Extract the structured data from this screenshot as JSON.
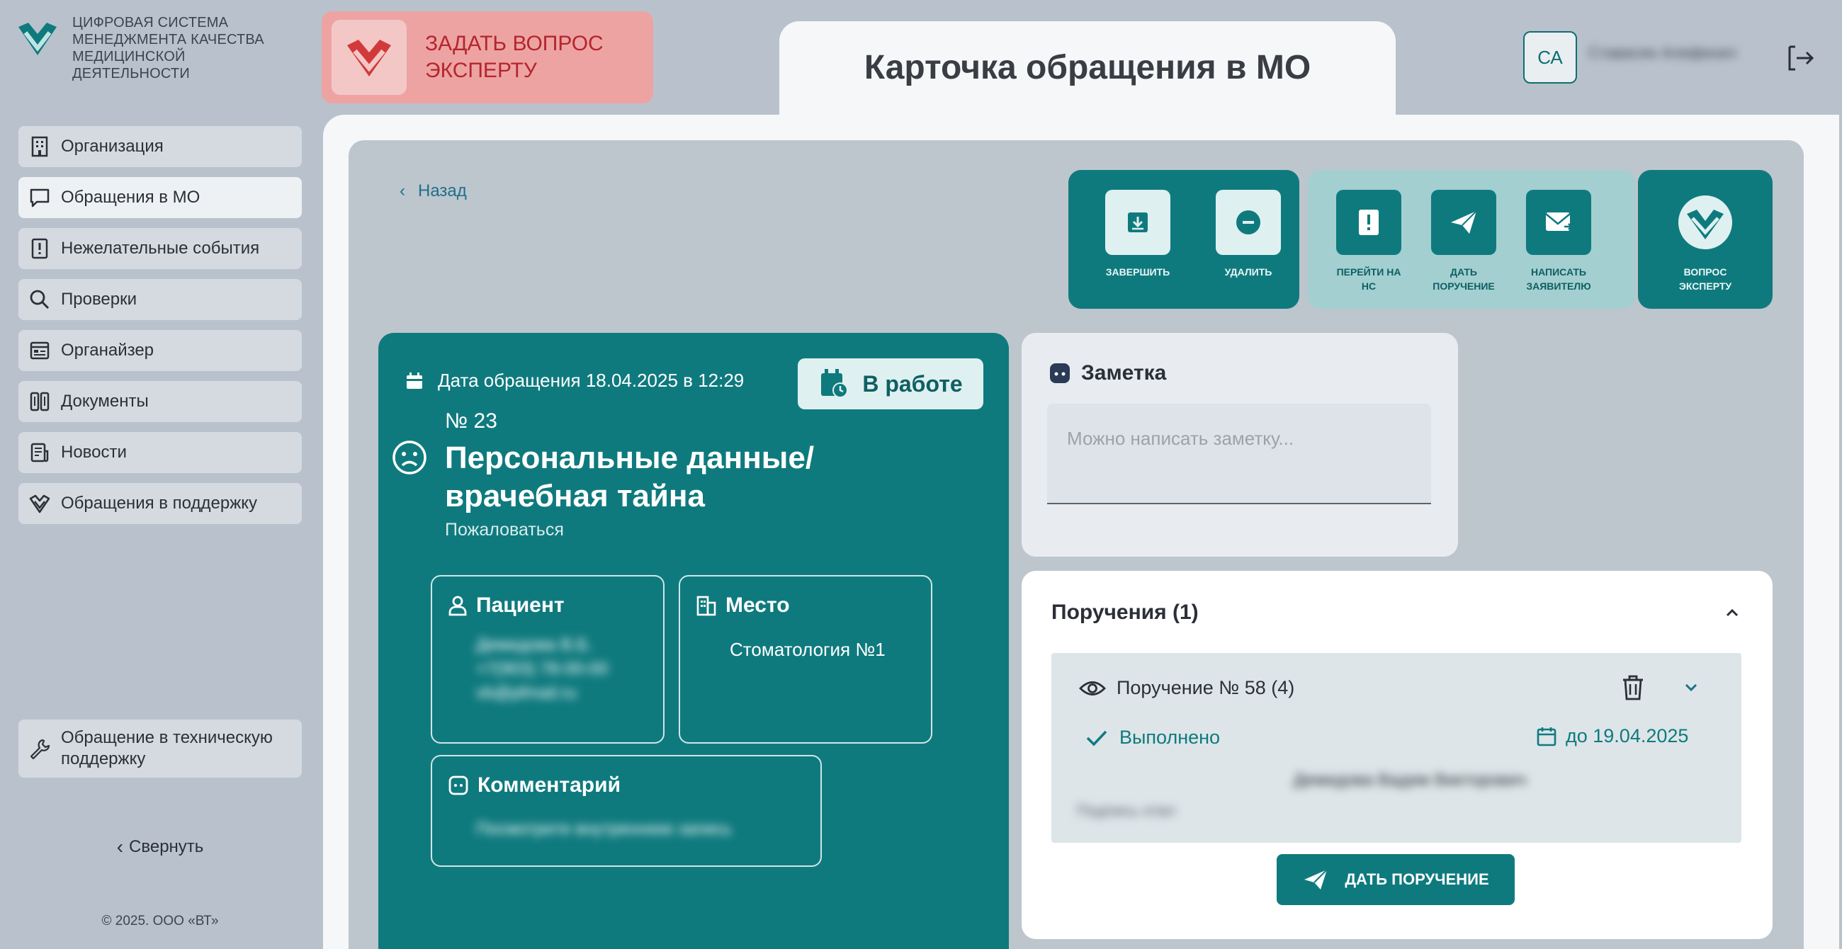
{
  "brand": {
    "name": "ЦИФРОВАЯ СИСТЕМА\nМЕНЕДЖМЕНТА КАЧЕСТВА\nМЕДИЦИНСКОЙ\nДЕЯТЕЛЬНОСТИ",
    "accent": "#0f7a7e"
  },
  "sidebar": {
    "items": [
      {
        "label": "Организация",
        "icon": "building-icon"
      },
      {
        "label": "Обращения в МО",
        "icon": "chat-icon",
        "active": true
      },
      {
        "label": "Нежелательные события",
        "icon": "alert-book-icon"
      },
      {
        "label": "Проверки",
        "icon": "search-icon"
      },
      {
        "label": "Органайзер",
        "icon": "organizer-icon"
      },
      {
        "label": "Документы",
        "icon": "documents-icon"
      },
      {
        "label": "Новости",
        "icon": "news-icon"
      },
      {
        "label": "Обращения в поддержку",
        "icon": "support-icon"
      }
    ],
    "tech_support": "Обращение в техническую поддержку",
    "collapse": "Свернуть",
    "copyright": "© 2025. ООО «ВТ»"
  },
  "header": {
    "ask_expert": "ЗАДАТЬ ВОПРОС\nЭКСПЕРТУ",
    "title": "Карточка обращения в МО",
    "avatar_initials": "СА",
    "username": "Стависян Алефенич"
  },
  "toolbar": {
    "back": "Назад",
    "finish": "ЗАВЕРШИТЬ",
    "delete": "УДАЛИТЬ",
    "go_to_ns": "ПЕРЕЙТИ НА\nНС",
    "give_order": "ДАТЬ\nПОРУЧЕНИЕ",
    "write_applicant": "НАПИСАТЬ\nЗАЯВИТЕЛЮ",
    "ask_expert": "ВОПРОС\nЭКСПЕРТУ"
  },
  "case": {
    "date": "Дата обращения 18.04.2025 в 12:29",
    "status": "В работе",
    "number": "№ 23",
    "title": "Персональные данные/ врачебная тайна",
    "type": "Пожаловаться",
    "patient_label": "Пациент",
    "patient_value": "Демидова В.Б. +7(903) 78-00-00 vb@pfmail.ru",
    "place_label": "Место",
    "place_value": "Стоматология №1",
    "comment_label": "Комментарий",
    "comment_value": "Посмотрите внутреннюю запись"
  },
  "note": {
    "title": "Заметка",
    "placeholder": "Можно написать заметку..."
  },
  "orders": {
    "title": "Поручения (1)",
    "item_title": "Поручение № 58 (4)",
    "item_status": "Выполнено",
    "item_due": "до 19.04.2025",
    "item_person": "Демидова Вадим Викторович",
    "item_role": "Подпись отвл",
    "give_order_button": "ДАТЬ ПОРУЧЕНИЕ"
  }
}
